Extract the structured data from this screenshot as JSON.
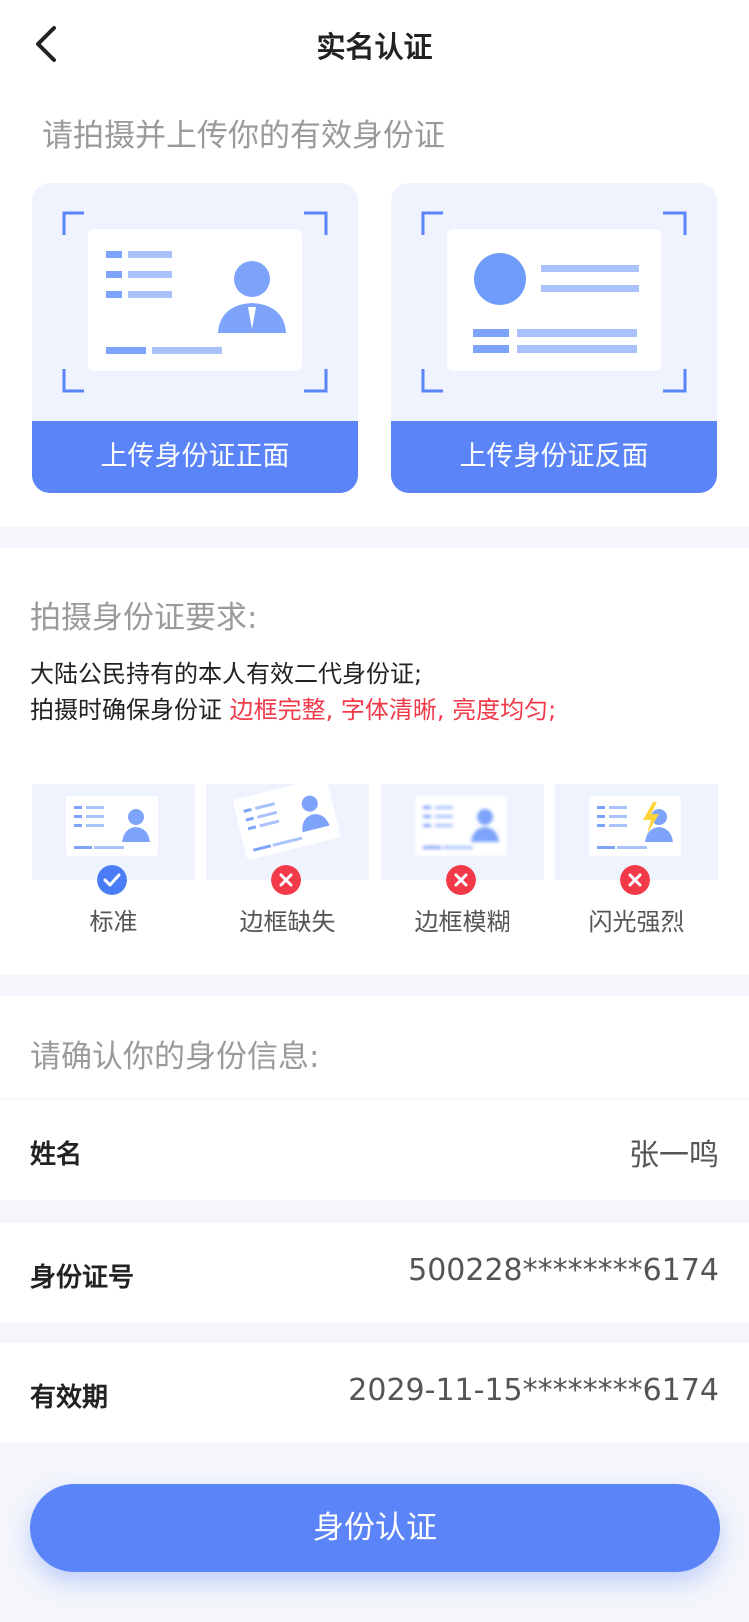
{
  "header": {
    "title": "实名认证",
    "back_icon": "chevron-left-icon"
  },
  "upload": {
    "prompt": "请拍摄并上传你的有效身份证",
    "front_label": "上传身份证正面",
    "back_label": "上传身份证反面"
  },
  "requirements": {
    "title": "拍摄身份证要求:",
    "line1": "大陆公民持有的本人有效二代身份证;",
    "line2_prefix": "拍摄时确保身份证 ",
    "line2_highlight": "边框完整, 字体清晰, 亮度均匀;",
    "samples": [
      {
        "label": "标准",
        "status": "ok"
      },
      {
        "label": "边框缺失",
        "status": "bad"
      },
      {
        "label": "边框模糊",
        "status": "bad"
      },
      {
        "label": "闪光强烈",
        "status": "bad"
      }
    ]
  },
  "confirm": {
    "title": "请确认你的身份信息:",
    "name_label": "姓名",
    "name_value": "张一鸣",
    "id_label": "身份证号",
    "id_value": "500228********6174",
    "expiry_label": "有效期",
    "expiry_value": "2029-11-15********6174"
  },
  "submit_label": "身份认证",
  "colors": {
    "primary": "#5b84f8",
    "highlight": "#f2394a",
    "ok": "#4a7cf6",
    "bad": "#f2394a"
  }
}
